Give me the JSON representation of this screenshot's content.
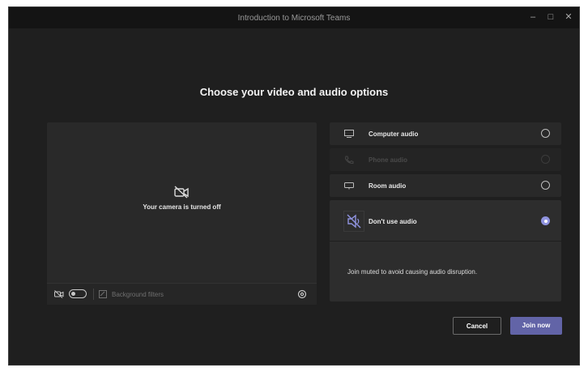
{
  "window": {
    "title": "Introduction to Microsoft Teams",
    "minimize_glyph": "–",
    "maximize_glyph": "□",
    "close_glyph": "✕"
  },
  "heading": "Choose your video and audio options",
  "video": {
    "camera_off_text": "Your camera is turned off",
    "camera_toggle_on": false,
    "background_filters_label": "Background filters"
  },
  "audio_options": [
    {
      "label": "Computer audio",
      "icon": "computer-audio-icon",
      "selected": false,
      "disabled": false
    },
    {
      "label": "Phone audio",
      "icon": "phone-icon",
      "selected": false,
      "disabled": true
    },
    {
      "label": "Room audio",
      "icon": "room-audio-icon",
      "selected": false,
      "disabled": false
    },
    {
      "label": "Don't use audio",
      "icon": "no-audio-icon",
      "selected": true,
      "disabled": false
    }
  ],
  "no_audio_hint": "Join muted to avoid causing audio disruption.",
  "buttons": {
    "cancel": "Cancel",
    "join": "Join now"
  },
  "colors": {
    "window_bg": "#1f1f1f",
    "panel_bg": "#292929",
    "accent": "#6264a7",
    "radio_selected": "#8f93df"
  }
}
